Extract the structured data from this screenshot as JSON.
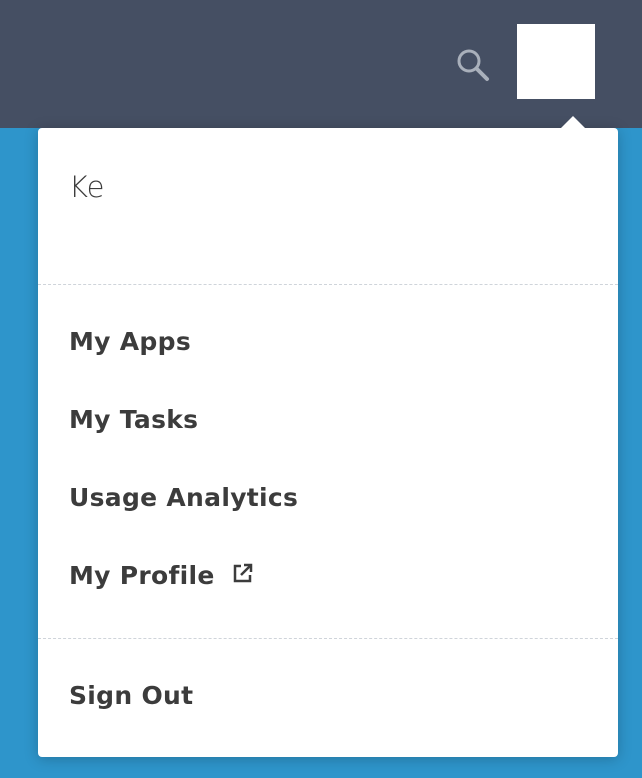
{
  "header": {
    "search_icon": "search-icon",
    "avatar": "user-avatar"
  },
  "menu": {
    "user_name": "Ke",
    "items": [
      {
        "label": "My Apps"
      },
      {
        "label": "My Tasks"
      },
      {
        "label": "Usage Analytics"
      },
      {
        "label": "My Profile",
        "icon": "external-link-icon"
      }
    ],
    "sign_out": "Sign Out"
  },
  "colors": {
    "header_bg": "#454f63",
    "page_bg": "#2e95cb",
    "menu_bg": "#ffffff",
    "text": "#3c3c3c"
  }
}
